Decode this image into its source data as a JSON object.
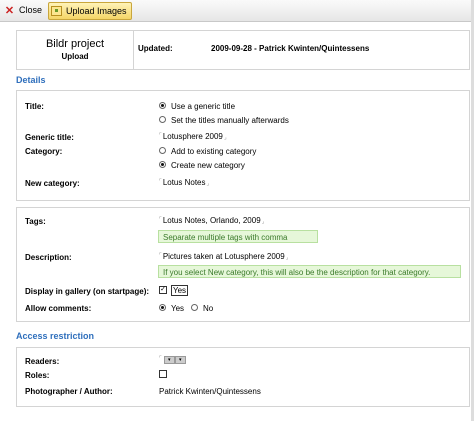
{
  "toolbar": {
    "close_label": "Close",
    "upload_label": "Upload Images"
  },
  "header": {
    "project_name": "Bildr project",
    "project_action": "Upload",
    "updated_label": "Updated:",
    "updated_value": "2009-09-28 - Patrick Kwinten/Quintessens"
  },
  "details": {
    "section_title": "Details",
    "title_label": "Title:",
    "title_options": [
      "Use a generic title",
      "Set the titles manually afterwards"
    ],
    "title_selected": 0,
    "generic_title_label": "Generic title:",
    "generic_title_value": "Lotusphere 2009",
    "category_label": "Category:",
    "category_options": [
      "Add to existing category",
      "Create new category"
    ],
    "category_selected": 1,
    "new_category_label": "New category:",
    "new_category_value": "Lotus Notes"
  },
  "meta": {
    "tags_label": "Tags:",
    "tags_value": "Lotus Notes, Orlando, 2009",
    "tags_hint": "Separate multiple tags with comma",
    "description_label": "Description:",
    "description_value": "Pictures taken at Lotusphere 2009",
    "description_hint": "If you select New category, this will also be the description for that category.",
    "gallery_label": "Display in gallery (on startpage):",
    "gallery_value": "Yes",
    "gallery_checked": true,
    "comments_label": "Allow comments:",
    "comments_options": [
      "Yes",
      "No"
    ],
    "comments_selected": 0
  },
  "access": {
    "section_title": "Access restriction",
    "readers_label": "Readers:",
    "roles_label": "Roles:",
    "roles_checked": false,
    "photographer_label": "Photographer / Author:",
    "photographer_value": "Patrick Kwinten/Quintessens"
  }
}
